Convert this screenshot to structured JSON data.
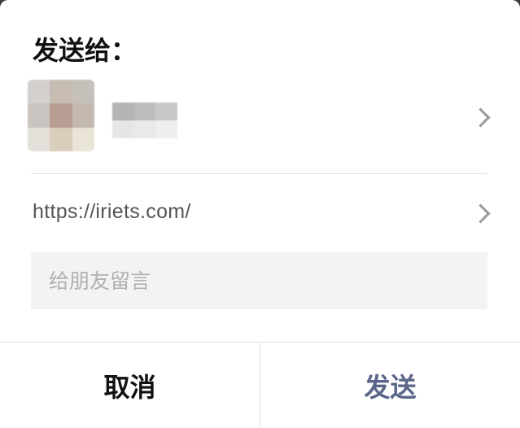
{
  "dialog": {
    "title": "发送给："
  },
  "recipient": {
    "avatar_pixels": [
      "#d3d0ce",
      "#c7bcb2",
      "#c6c0bb",
      "#c9c4c0",
      "#b89d93",
      "#c4b9b1",
      "#e4e0da",
      "#d9cebc",
      "#e9e4d6"
    ],
    "name_pixels": [
      "#b4b4b4",
      "#bcbcbc",
      "#c8c8c8",
      "#e6e6e6",
      "#e9e9e9",
      "#efefef"
    ]
  },
  "link": {
    "url": "https://iriets.com/"
  },
  "message": {
    "placeholder": "给朋友留言",
    "value": ""
  },
  "footer": {
    "cancel_label": "取消",
    "send_label": "发送"
  },
  "colors": {
    "send_accent": "#5a6589",
    "input_bg": "#f3f3f3"
  }
}
